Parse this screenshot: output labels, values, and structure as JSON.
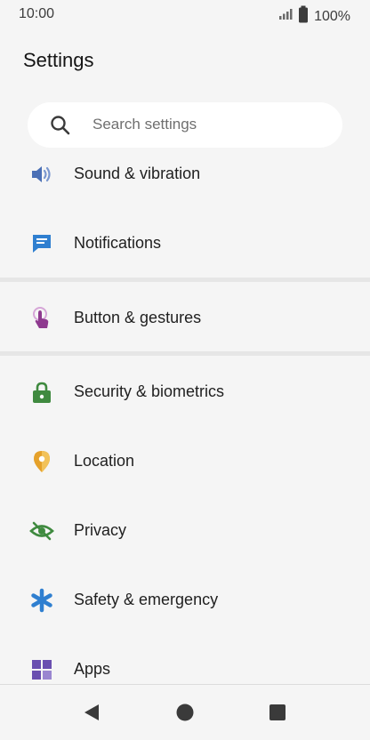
{
  "status_bar": {
    "time": "10:00",
    "battery": "100%"
  },
  "header": {
    "title": "Settings"
  },
  "search": {
    "placeholder": "Search settings"
  },
  "items": [
    {
      "label": "Sound & vibration",
      "icon": "speaker-icon",
      "color": "#4a6fb5"
    },
    {
      "label": "Notifications",
      "icon": "notification-icon",
      "color": "#2f7fd0"
    },
    {
      "label": "Button & gestures",
      "icon": "gesture-hand-icon",
      "color": "#8e3a8f"
    },
    {
      "label": "Security & biometrics",
      "icon": "lock-icon",
      "color": "#3f8a3f"
    },
    {
      "label": "Location",
      "icon": "location-pin-icon",
      "color": "#e5a12a"
    },
    {
      "label": "Privacy",
      "icon": "eye-off-icon",
      "color": "#3f8a3f"
    },
    {
      "label": "Safety & emergency",
      "icon": "asterisk-icon",
      "color": "#2f7fd0"
    },
    {
      "label": "Apps",
      "icon": "apps-grid-icon",
      "color": "#6a4fb0"
    }
  ]
}
